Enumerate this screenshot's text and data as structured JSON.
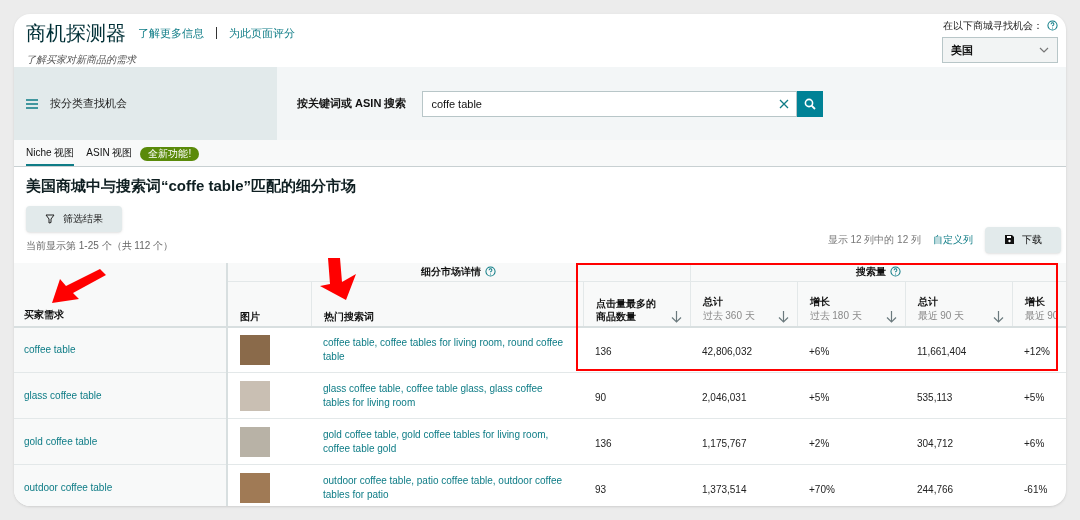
{
  "header": {
    "title": "商机探测器",
    "links": [
      "了解更多信息",
      "为此页面评分"
    ],
    "subtitle": "了解买家对新商品的需求",
    "marketplace": {
      "label": "在以下商城寻找机会：",
      "value": "美国"
    }
  },
  "category_button": "按分类查找机会",
  "search": {
    "label": "按关键词或 ASIN 搜索",
    "value": "coffe table"
  },
  "tabs": [
    {
      "label": "Niche 视图",
      "selected": true
    },
    {
      "label": "ASIN 视图",
      "selected": false
    }
  ],
  "new_badge": "全新功能!",
  "heading": "美国商城中与搜索词“coffe table”匹配的细分市场",
  "filter_button": "筛选结果",
  "result_count": "当前显示第 1-25 个（共 112 个）",
  "columns_info": "显示 12 列中的 12 列",
  "customize_link": "自定义列",
  "download_button": "下载",
  "table": {
    "groups": [
      {
        "label": "细分市场详情"
      },
      {
        "label": "搜索量"
      }
    ],
    "columns": [
      {
        "title": "买家需求",
        "kind": "link",
        "sortable": false
      },
      {
        "title": "图片",
        "kind": "image",
        "sortable": false
      },
      {
        "title": "热门搜索词",
        "kind": "link",
        "sortable": false
      },
      {
        "title": "点击量最多的商品数量",
        "kind": "text",
        "sortable": true
      },
      {
        "title": "总计",
        "subtitle": "过去 360 天",
        "kind": "text",
        "sortable": true
      },
      {
        "title": "增长",
        "subtitle": "过去 180 天",
        "kind": "text",
        "sortable": true
      },
      {
        "title": "总计",
        "subtitle": "最近 90 天",
        "kind": "text",
        "sortable": true
      },
      {
        "title": "增长",
        "subtitle": "最近 90",
        "kind": "text",
        "sortable": false
      }
    ],
    "rows": [
      {
        "cells": [
          "coffee table",
          "",
          "coffee table, coffee tables for living room, round coffee table",
          "136",
          "42,806,032",
          "+6%",
          "11,661,404",
          "+12%"
        ]
      },
      {
        "cells": [
          "glass coffee table",
          "",
          "glass coffee table, coffee table glass, glass coffee tables for living room",
          "90",
          "2,046,031",
          "+5%",
          "535,113",
          "+5%"
        ]
      },
      {
        "cells": [
          "gold coffee table",
          "",
          "gold coffee table, gold coffee tables for living room, coffee table gold",
          "136",
          "1,175,767",
          "+2%",
          "304,712",
          "+6%"
        ]
      },
      {
        "cells": [
          "outdoor coffee table",
          "",
          "outdoor coffee table, patio coffee table, outdoor coffee tables for patio",
          "93",
          "1,373,514",
          "+70%",
          "244,766",
          "-61%"
        ]
      }
    ]
  }
}
